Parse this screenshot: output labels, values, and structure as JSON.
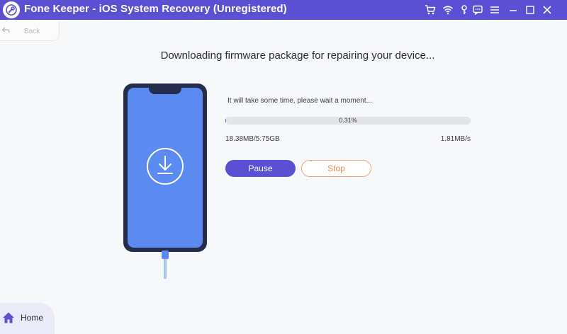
{
  "window": {
    "title": "Fone Keeper - iOS System Recovery (Unregistered)",
    "accent_color": "#5b4fd4"
  },
  "titlebar_icons": [
    "cart-icon",
    "wifi-icon",
    "key-icon",
    "feedback-icon",
    "menu-icon",
    "minimize-icon",
    "close-icon"
  ],
  "nav": {
    "back_label": "Back",
    "home_label": "Home"
  },
  "main": {
    "headline": "Downloading firmware package for repairing your device...",
    "wait_message": "It will take some time, please wait a moment...",
    "progress_percent": 0.31,
    "progress_label": "0.31%",
    "downloaded": "18.38MB/5.75GB",
    "speed": "1.81MB/s",
    "pause_label": "Pause",
    "stop_label": "Stop",
    "stop_color": "#f08a4b",
    "phone_icon": "download-icon"
  }
}
